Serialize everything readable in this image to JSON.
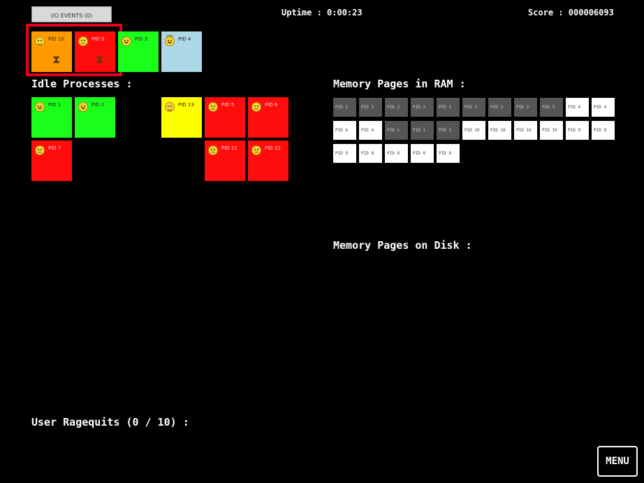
{
  "header": {
    "io_events": "I/O EVENTS (0)",
    "uptime": "Uptime : 0:00:23",
    "score": "Score : 000006093"
  },
  "cpu_processes": [
    {
      "pid": "PID 10",
      "color": "orange",
      "mood": "neutral",
      "waiting_io": true
    },
    {
      "pid": "PID 9",
      "color": "red",
      "mood": "sad",
      "waiting_io": true
    },
    {
      "pid": "PID 3",
      "color": "green",
      "mood": "happy",
      "waiting_io": false
    },
    {
      "pid": "PID 4",
      "color": "blue",
      "mood": "angel",
      "waiting_io": false
    }
  ],
  "idle": {
    "title": "Idle Processes :",
    "processes": [
      {
        "pid": "PID 1",
        "color": "green",
        "mood": "happy"
      },
      {
        "pid": "PID 2",
        "color": "green",
        "mood": "happy"
      },
      {
        "pid": "PID 13",
        "color": "yellow",
        "mood": "neutral"
      },
      {
        "pid": "PID 5",
        "color": "red",
        "mood": "sad"
      },
      {
        "pid": "PID 6",
        "color": "red",
        "mood": "sad"
      },
      {
        "pid": "PID 7",
        "color": "red",
        "mood": "sad"
      },
      {
        "pid": "PID 11",
        "color": "red",
        "mood": "sad"
      },
      {
        "pid": "PID 12",
        "color": "red",
        "mood": "sad"
      }
    ]
  },
  "ram": {
    "title": "Memory Pages in RAM :",
    "pages": [
      {
        "label": "PID 1",
        "state": "used"
      },
      {
        "label": "PID 1",
        "state": "used"
      },
      {
        "label": "PID 2",
        "state": "used"
      },
      {
        "label": "PID 2",
        "state": "used"
      },
      {
        "label": "PID 2",
        "state": "used"
      },
      {
        "label": "PID 2",
        "state": "used"
      },
      {
        "label": "PID 3",
        "state": "used"
      },
      {
        "label": "PID 3",
        "state": "used"
      },
      {
        "label": "PID 3",
        "state": "used"
      },
      {
        "label": "PID 4",
        "state": "free"
      },
      {
        "label": "PID 4",
        "state": "free"
      },
      {
        "label": "PID 4",
        "state": "free"
      },
      {
        "label": "PID 4",
        "state": "free"
      },
      {
        "label": "PID 1",
        "state": "used"
      },
      {
        "label": "PID 1",
        "state": "used"
      },
      {
        "label": "PID 3",
        "state": "used"
      },
      {
        "label": "PID 10",
        "state": "free"
      },
      {
        "label": "PID 10",
        "state": "free"
      },
      {
        "label": "PID 10",
        "state": "free"
      },
      {
        "label": "PID 10",
        "state": "free"
      },
      {
        "label": "PID 9",
        "state": "free"
      },
      {
        "label": "PID 9",
        "state": "free"
      },
      {
        "label": "PID 9",
        "state": "free"
      },
      {
        "label": "PID 8",
        "state": "free"
      },
      {
        "label": "PID 8",
        "state": "free"
      },
      {
        "label": "PID 8",
        "state": "free"
      },
      {
        "label": "PID 8",
        "state": "free"
      }
    ]
  },
  "disk": {
    "title": "Memory Pages on Disk :"
  },
  "ragequits": "User Ragequits (0 / 10) :",
  "menu_label": "MENU"
}
